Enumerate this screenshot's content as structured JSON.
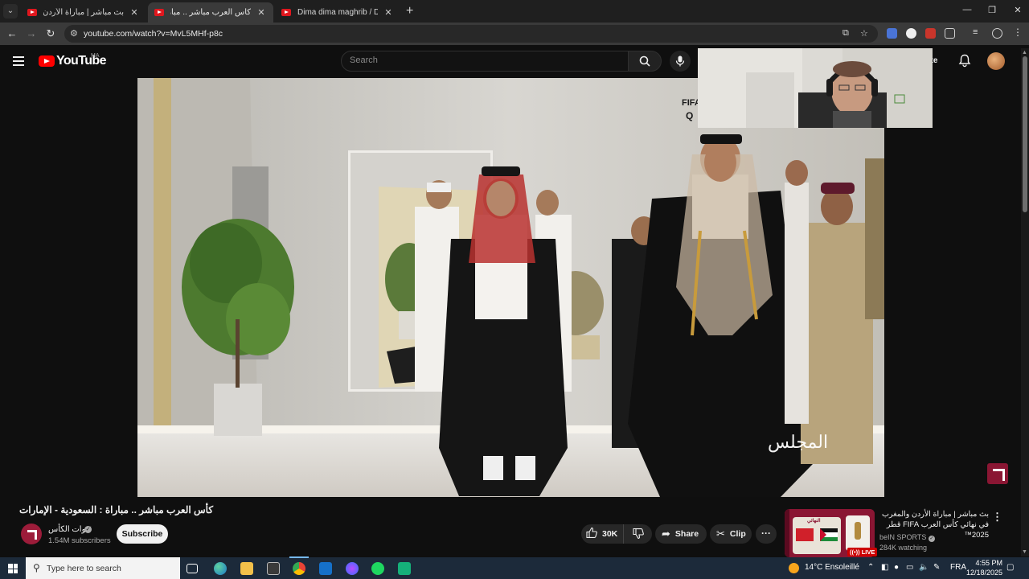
{
  "browser": {
    "tabs": [
      {
        "title": "بث مباشر | مباراة الأردن والمغرب",
        "active": false
      },
      {
        "title": "كأس العرب مباشر .. مباراة : السعو",
        "active": true
      },
      {
        "title": "Dima dima maghrib / Dima ma",
        "active": false
      }
    ],
    "url": "youtube.com/watch?v=MvL5MHf-p8c",
    "window_controls": [
      "minimize-icon",
      "restore-icon",
      "close-icon"
    ]
  },
  "youtube": {
    "logo_text": "YouTube",
    "country_code": "MA",
    "search_placeholder": "Search",
    "create_label": "ate"
  },
  "video_overlay": {
    "fifa_text": "FIFA",
    "qatar_text": "Q",
    "watermark": "المجلس"
  },
  "video_info": {
    "title": "كأس العرب مباشر .. مباراة : السعودية - الإمارات",
    "channel_name": "قنوات الكأس",
    "subscribers": "1.54M subscribers",
    "subscribe_label": "Subscribe",
    "likes": "30K",
    "share_label": "Share",
    "clip_label": "Clip"
  },
  "recommendation": {
    "title": "بث مباشر | مباراة الأردن والمغرب في نهائي كأس العرب FIFA قطر 2025™",
    "channel": "beIN SPORTS",
    "watching": "284K watching",
    "live_badge": "LIVE",
    "thumb_banner": "النهائي"
  },
  "taskbar": {
    "search_placeholder": "Type here to search",
    "weather": "14°C  Ensoleillé",
    "language": "FRA",
    "time": "4:55 PM",
    "date": "12/18/2025",
    "pinned_icons": [
      "task-view-icon",
      "edge-icon",
      "file-explorer-icon",
      "store-icon",
      "chrome-icon",
      "outlook-icon",
      "messenger-icon",
      "spotify-icon",
      "app-icon"
    ]
  },
  "colors": {
    "youtube_red": "#ff0000",
    "channel_brand": "#9c1c3a",
    "taskbar": "#1c2a3a"
  }
}
